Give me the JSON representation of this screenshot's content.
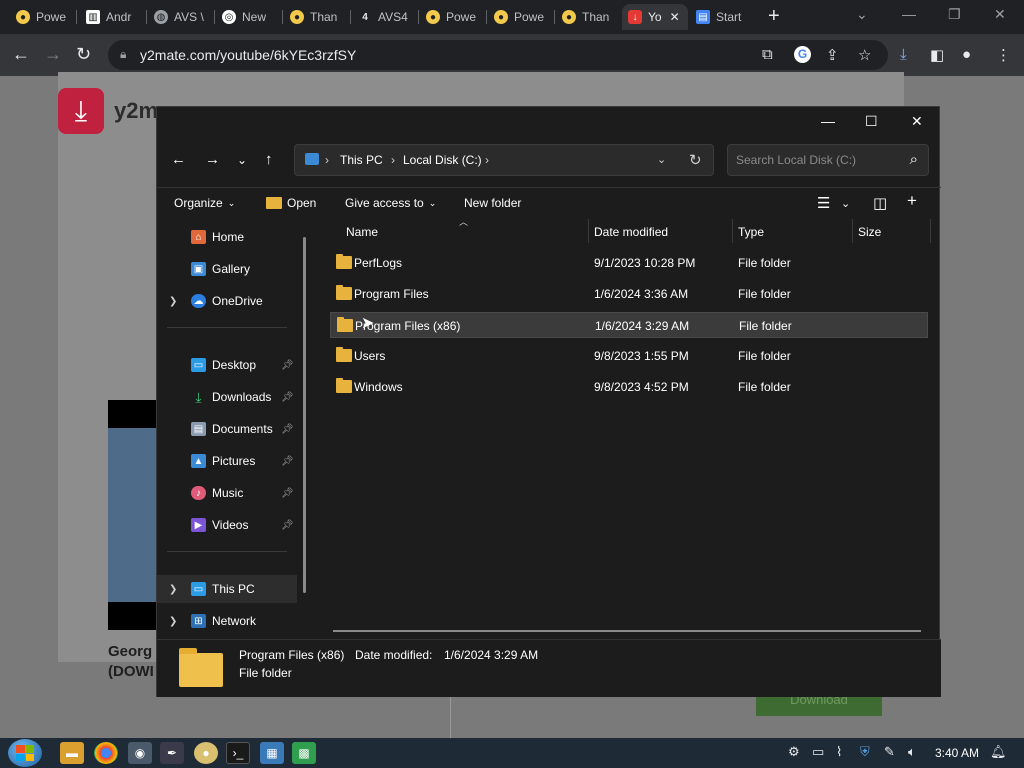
{
  "browser": {
    "tabs": [
      {
        "label": "Powe",
        "color": "#f2c94c",
        "glyph": "●"
      },
      {
        "label": "Andr",
        "color": "#ffffff",
        "glyph": "▥"
      },
      {
        "label": "AVS \\",
        "color": "#9aa0a6",
        "glyph": "◍"
      },
      {
        "label": "New",
        "color": "#ffffff",
        "glyph": "◎"
      },
      {
        "label": "Than",
        "color": "#f2c94c",
        "glyph": "●"
      },
      {
        "label": "AVS4",
        "color": "#202124",
        "glyph": "4"
      },
      {
        "label": "Powe",
        "color": "#f2c94c",
        "glyph": "●"
      },
      {
        "label": "Powe",
        "color": "#f2c94c",
        "glyph": "●"
      },
      {
        "label": "Than",
        "color": "#f2c94c",
        "glyph": "●"
      },
      {
        "label": "Yo",
        "color": "#e53935",
        "glyph": "↓"
      },
      {
        "label": "Start",
        "color": "#4285f4",
        "glyph": "▤"
      }
    ],
    "url": "y2mate.com/youtube/6kYEc3rzfSY"
  },
  "webpage": {
    "logo_text": "y2m",
    "video_title_line1": "Georg",
    "video_title_line2": "(DOWI",
    "download_button": "Download"
  },
  "explorer": {
    "address": {
      "this_pc": "This PC",
      "local_disk": "Local Disk (C:)"
    },
    "search_placeholder": "Search Local Disk (C:)",
    "commands": {
      "organize": "Organize",
      "open": "Open",
      "give_access": "Give access to",
      "new_folder": "New folder"
    },
    "sidebar": {
      "home": "Home",
      "gallery": "Gallery",
      "onedrive": "OneDrive",
      "desktop": "Desktop",
      "downloads": "Downloads",
      "documents": "Documents",
      "pictures": "Pictures",
      "music": "Music",
      "videos": "Videos",
      "this_pc": "This PC",
      "network": "Network"
    },
    "columns": {
      "name": "Name",
      "date_modified": "Date modified",
      "type": "Type",
      "size": "Size"
    },
    "rows": [
      {
        "name": "PerfLogs",
        "date": "9/1/2023 10:28 PM",
        "type": "File folder"
      },
      {
        "name": "Program Files",
        "date": "1/6/2024 3:36 AM",
        "type": "File folder"
      },
      {
        "name": "Program Files (x86)",
        "date": "1/6/2024 3:29 AM",
        "type": "File folder"
      },
      {
        "name": "Users",
        "date": "9/8/2023 1:55 PM",
        "type": "File folder"
      },
      {
        "name": "Windows",
        "date": "9/8/2023 4:52 PM",
        "type": "File folder"
      }
    ],
    "details": {
      "name": "Program Files (x86)",
      "date_label": "Date modified:",
      "date_value": "1/6/2024 3:29 AM",
      "type": "File folder"
    }
  },
  "taskbar": {
    "clock": "3:40 AM"
  }
}
